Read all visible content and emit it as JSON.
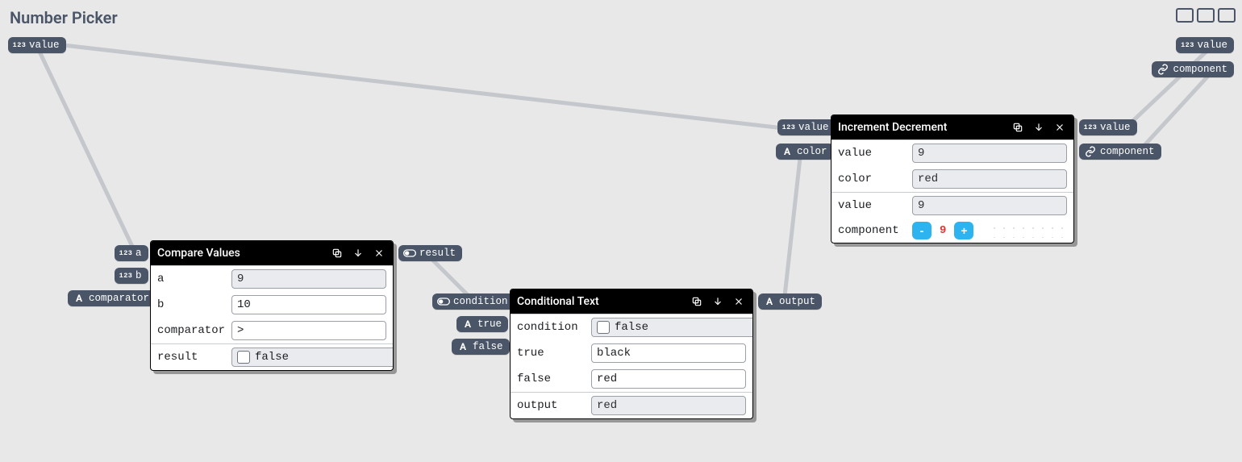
{
  "title": "Number Picker",
  "port_icons": {
    "number": "123",
    "text": "A",
    "bool": "toggle",
    "link": "link"
  },
  "ports": {
    "tl_value": {
      "type": "number",
      "label": "value"
    },
    "tr_value": {
      "type": "number",
      "label": "value"
    },
    "tr_component": {
      "type": "link",
      "label": "component"
    },
    "cv_in_a": {
      "type": "number",
      "label": "a"
    },
    "cv_in_b": {
      "type": "number",
      "label": "b"
    },
    "cv_in_comparator": {
      "type": "text",
      "label": "comparator"
    },
    "cv_out_result": {
      "type": "bool",
      "label": "result"
    },
    "ct_in_condition": {
      "type": "bool",
      "label": "condition"
    },
    "ct_in_true": {
      "type": "text",
      "label": "true"
    },
    "ct_in_false": {
      "type": "text",
      "label": "false"
    },
    "ct_out_output": {
      "type": "text",
      "label": "output"
    },
    "id_in_value": {
      "type": "number",
      "label": "value"
    },
    "id_in_color": {
      "type": "text",
      "label": "color"
    },
    "id_out_value": {
      "type": "number",
      "label": "value"
    },
    "id_out_component": {
      "type": "link",
      "label": "component"
    }
  },
  "nodes": {
    "compare": {
      "title": "Compare Values",
      "fields": {
        "a": {
          "label": "a",
          "value": "9",
          "readonly": true
        },
        "b": {
          "label": "b",
          "value": "10",
          "readonly": false
        },
        "comparator": {
          "label": "comparator",
          "value": ">",
          "readonly": false
        },
        "result": {
          "label": "result",
          "value": "false",
          "checked": false
        }
      }
    },
    "conditional": {
      "title": "Conditional Text",
      "fields": {
        "condition": {
          "label": "condition",
          "value": "false",
          "checked": false
        },
        "true": {
          "label": "true",
          "value": "black",
          "readonly": false
        },
        "false": {
          "label": "false",
          "value": "red",
          "readonly": false
        },
        "output": {
          "label": "output",
          "value": "red",
          "readonly": true
        }
      }
    },
    "increment": {
      "title": "Increment Decrement",
      "fields": {
        "value_in": {
          "label": "value",
          "value": "9",
          "readonly": true
        },
        "color": {
          "label": "color",
          "value": "red",
          "readonly": true
        },
        "value_out": {
          "label": "value",
          "value": "9",
          "readonly": true
        },
        "component": {
          "label": "component",
          "minus": "-",
          "plus": "+",
          "display": "9"
        }
      }
    }
  }
}
